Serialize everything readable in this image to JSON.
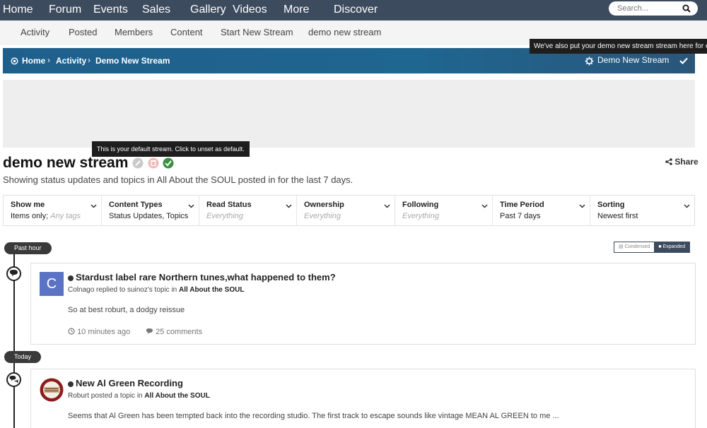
{
  "topnav": {
    "items": [
      "Home",
      "Forum",
      "Events",
      "Sales",
      "Gallery",
      "Videos",
      "More",
      "Discover"
    ],
    "search_placeholder": "Search..."
  },
  "subnav": {
    "items": [
      "Activity",
      "Posted",
      "Members",
      "Content",
      "Start New Stream",
      "demo new stream"
    ]
  },
  "breadcrumb": {
    "items": [
      "Home",
      "Activity",
      "Demo New Stream"
    ],
    "stream_menu_label": "Demo New Stream",
    "tooltip": "We've also put your demo new stream stream here for easy access"
  },
  "stream": {
    "title": "demo new stream",
    "default_tooltip": "This is your default stream. Click to unset as default.",
    "share_label": "Share",
    "description": "Showing status updates and topics in All About the SOUL posted in for the last 7 days."
  },
  "filters": [
    {
      "label": "Show me",
      "value": "Items only;",
      "value_muted": "Any tags"
    },
    {
      "label": "Content Types",
      "value": "Status Updates, Topics",
      "value_muted": ""
    },
    {
      "label": "Read Status",
      "value": "",
      "value_muted": "Everything"
    },
    {
      "label": "Ownership",
      "value": "",
      "value_muted": "Everything"
    },
    {
      "label": "Following",
      "value": "",
      "value_muted": "Everything"
    },
    {
      "label": "Time Period",
      "value": "Past 7 days",
      "value_muted": ""
    },
    {
      "label": "Sorting",
      "value": "Newest first",
      "value_muted": ""
    }
  ],
  "view_toggle": {
    "condensed": "Condensed",
    "expanded": "Expanded"
  },
  "timeline": {
    "groups": [
      "Past hour",
      "Today"
    ],
    "posts": [
      {
        "title": "Stardust label rare Northern tunes,what happened to them?",
        "author": "Colnago",
        "action": " replied to suinoz's topic in ",
        "forum": "All About the SOUL",
        "avatar_letter": "C",
        "body": "So at best roburt, a dodgy reissue",
        "time": "10 minutes ago",
        "comments": "25 comments"
      },
      {
        "title": "New Al Green Recording",
        "author": "Roburt",
        "action": " posted a topic in ",
        "forum": "All About the SOUL",
        "avatar_letter": "",
        "body": "Seems that Al Green has been tempted back into the recording studio. The first track to escape sounds like vintage MEAN AL GREEN to me ...",
        "time": "",
        "comments": ""
      }
    ]
  },
  "colors": {
    "nav_bg": "#3d4b5e",
    "crumb_bg": "#1f6690",
    "accent_green": "#3e8e41",
    "avatar_blue": "#5a73c4"
  }
}
